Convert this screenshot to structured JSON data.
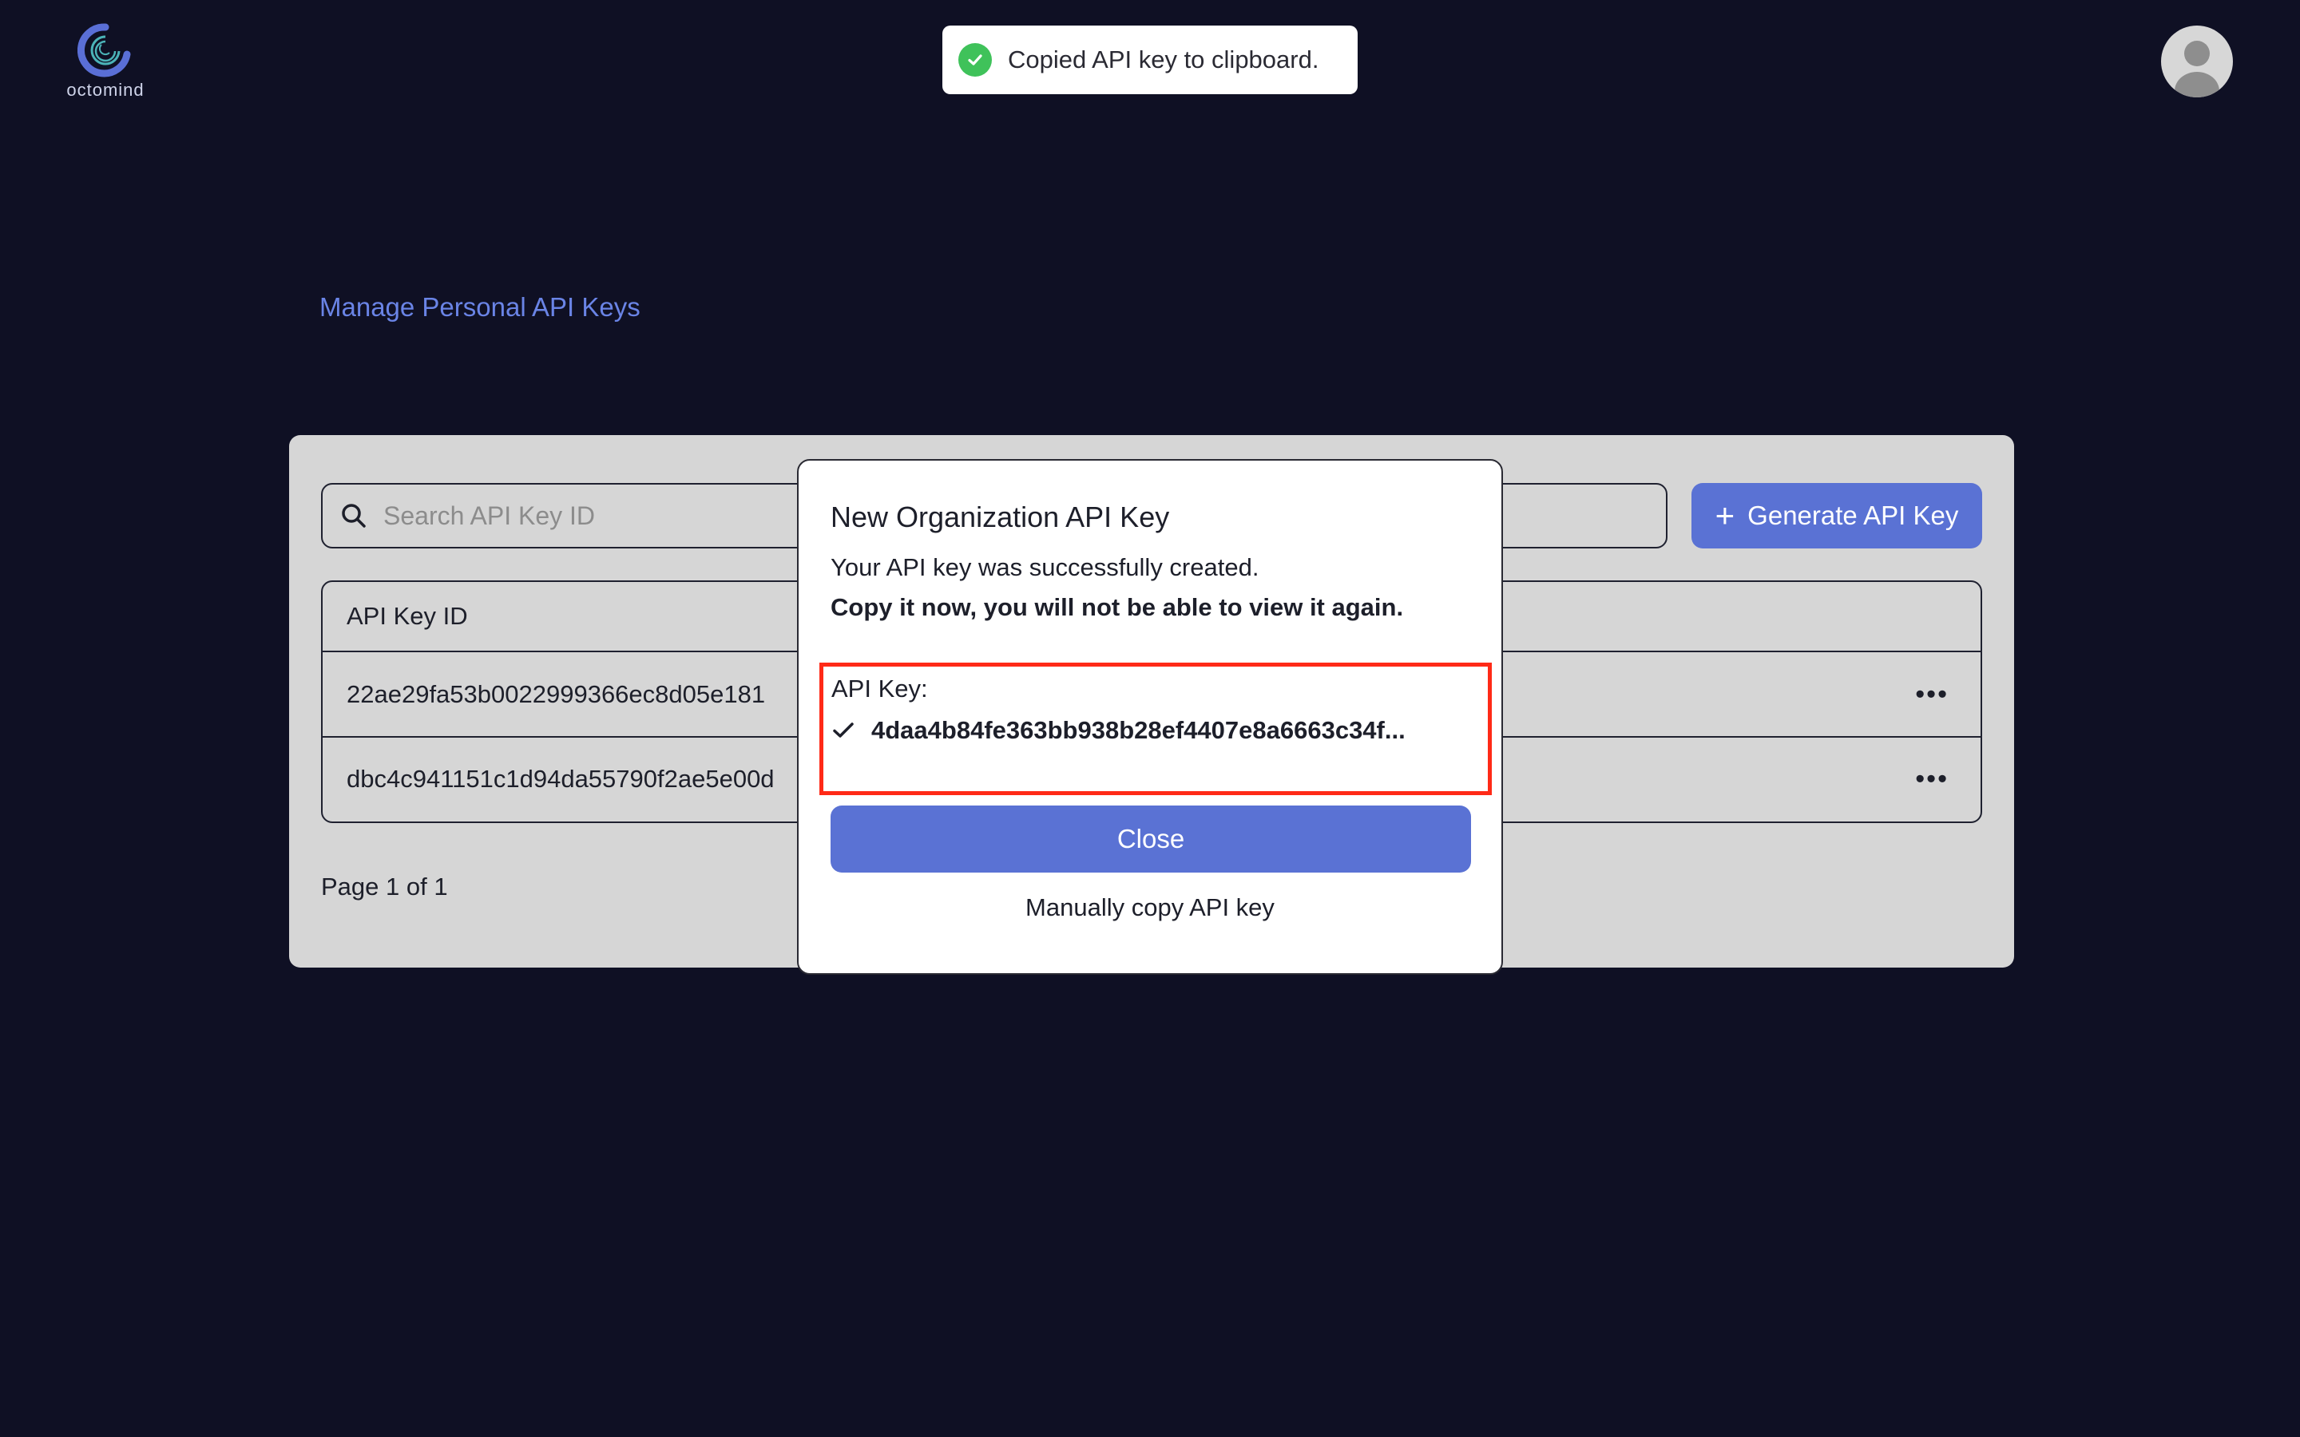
{
  "brand": {
    "name": "octomind"
  },
  "toast": {
    "message": "Copied API key to clipboard.",
    "icon": "check-circle-icon",
    "color": "#3fc25a"
  },
  "user": {
    "avatar": "user-avatar-icon"
  },
  "page": {
    "title": "Manage Personal API Keys"
  },
  "search": {
    "placeholder": "Search API Key ID",
    "value": ""
  },
  "toolbar": {
    "generate_label": "Generate API Key"
  },
  "table": {
    "columns": [
      "API Key ID"
    ],
    "rows": [
      {
        "id": "22ae29fa53b0022999366ec8d05e181",
        "actions": "•••"
      },
      {
        "id": "dbc4c941151c1d94da55790f2ae5e00d",
        "actions": "•••"
      }
    ]
  },
  "pagination": {
    "label": "Page 1 of 1"
  },
  "modal": {
    "title": "New Organization API Key",
    "line1": "Your API key was successfully created.",
    "line2": "Copy it now, you will not be able to view it again.",
    "key_label": "API Key:",
    "key_value": "4daa4b84fe363bb938b28ef4407e8a6663c34f...",
    "close_label": "Close",
    "manual_copy_label": "Manually copy API key"
  },
  "colors": {
    "accent": "#5a72d4",
    "highlight": "#ff2a17",
    "background": "#0f1024"
  }
}
